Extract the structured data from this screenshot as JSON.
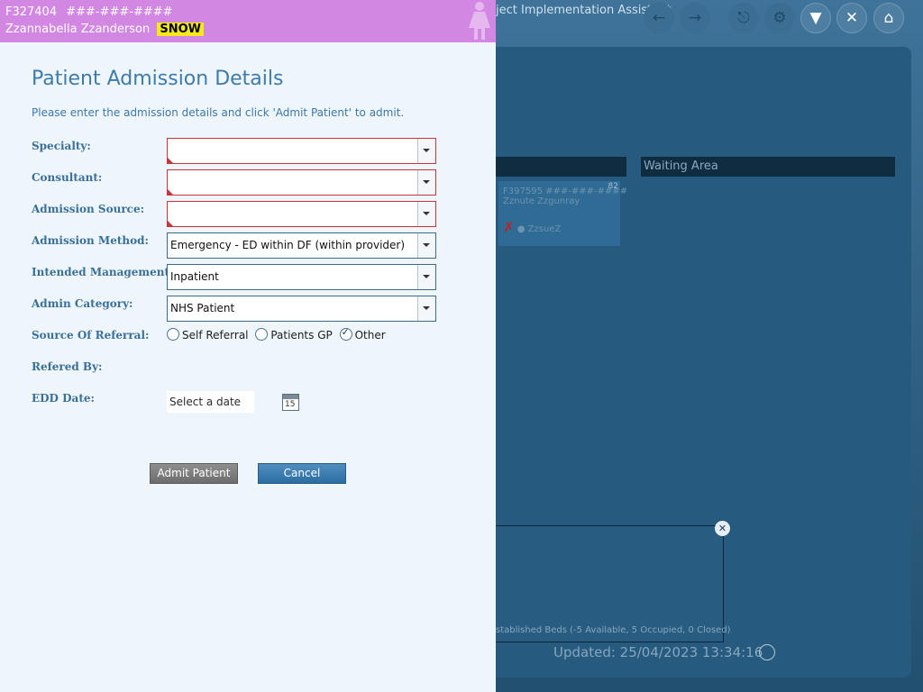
{
  "background_app": {
    "title": "ject Implementation Assistant",
    "columns": [
      "",
      "Waiting Area"
    ],
    "patient_card": {
      "id": "F397595",
      "nhs": "###-###-####",
      "name": "Zznute Zzgunray",
      "badge": "82",
      "flag": "ZzsueZ"
    },
    "beds_summary": "stablished Beds (-5 Available, 5 Occupied, 0 Closed)",
    "updated": "Updated: 25/04/2023 13:34:16"
  },
  "banner": {
    "patient_id": "F327404",
    "nhs_number": "###-###-####",
    "patient_name": "Zzannabella Zzanderson",
    "alert_badge": "SNOW",
    "color": "#d287e3"
  },
  "form": {
    "title": "Patient Admission Details",
    "instructions": "Please enter the admission details and click 'Admit Patient' to admit.",
    "fields": {
      "specialty": {
        "label": "Specialty:",
        "value": ""
      },
      "consultant": {
        "label": "Consultant:",
        "value": ""
      },
      "admission_source": {
        "label": "Admission Source:",
        "value": ""
      },
      "admission_method": {
        "label": "Admission Method:",
        "value": "Emergency - ED within DF (within provider)"
      },
      "intended_management": {
        "label": "Intended Management:",
        "value": "Inpatient"
      },
      "admin_category": {
        "label": "Admin Category:",
        "value": "NHS Patient"
      },
      "source_of_referral": {
        "label": "Source Of Referral:",
        "options": [
          "Self Referral",
          "Patients GP",
          "Other"
        ],
        "selected": "Other"
      },
      "referred_by": {
        "label": "Refered By:"
      },
      "edd_date": {
        "label": "EDD Date:",
        "placeholder": "Select a date",
        "calendar_day": "15"
      }
    },
    "buttons": {
      "admit": "Admit Patient",
      "cancel": "Cancel"
    },
    "colors": {
      "accent": "#3e7bab",
      "required": "#c6343d",
      "primary_button": "#2c6ea2"
    }
  }
}
